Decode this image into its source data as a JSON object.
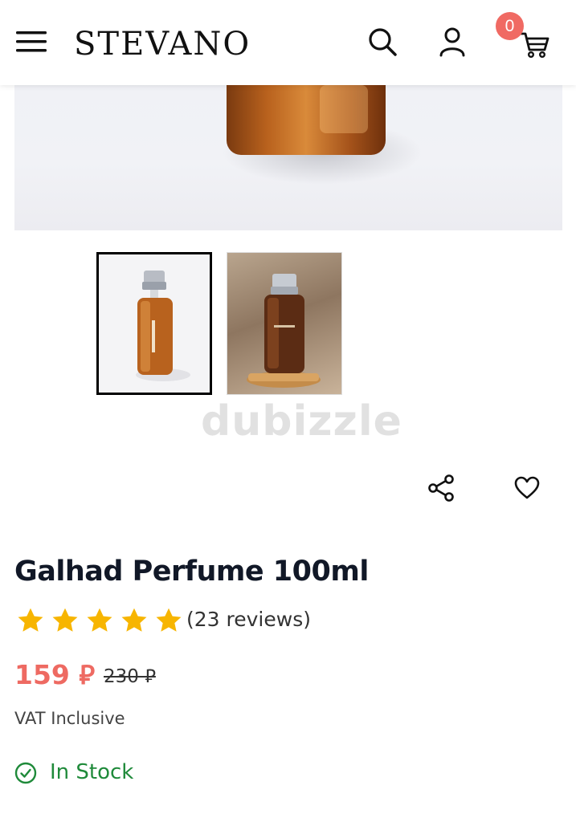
{
  "header": {
    "brand": "STEVANO",
    "cart_count": "0",
    "icons": [
      "menu-icon",
      "search-icon",
      "user-icon",
      "cart-icon"
    ]
  },
  "gallery": {
    "thumbnails": [
      "bottle-white-background",
      "bottle-wooden-stand"
    ],
    "selected_index": 0
  },
  "watermark": "dubizzle",
  "actions": {
    "icons": [
      "share-icon",
      "heart-icon"
    ]
  },
  "product": {
    "title": "Galhad Perfume 100ml",
    "rating": 5,
    "reviews_label": "(23 reviews)",
    "price": "159 ⃁",
    "old_price": "230 ⃁",
    "vat_label": "VAT Inclusive",
    "stock_label": "In Stock"
  },
  "colors": {
    "accent_price": "#ee6a62",
    "star": "#f7b500",
    "stock": "#1f8a3a",
    "badge": "#f06a63"
  }
}
